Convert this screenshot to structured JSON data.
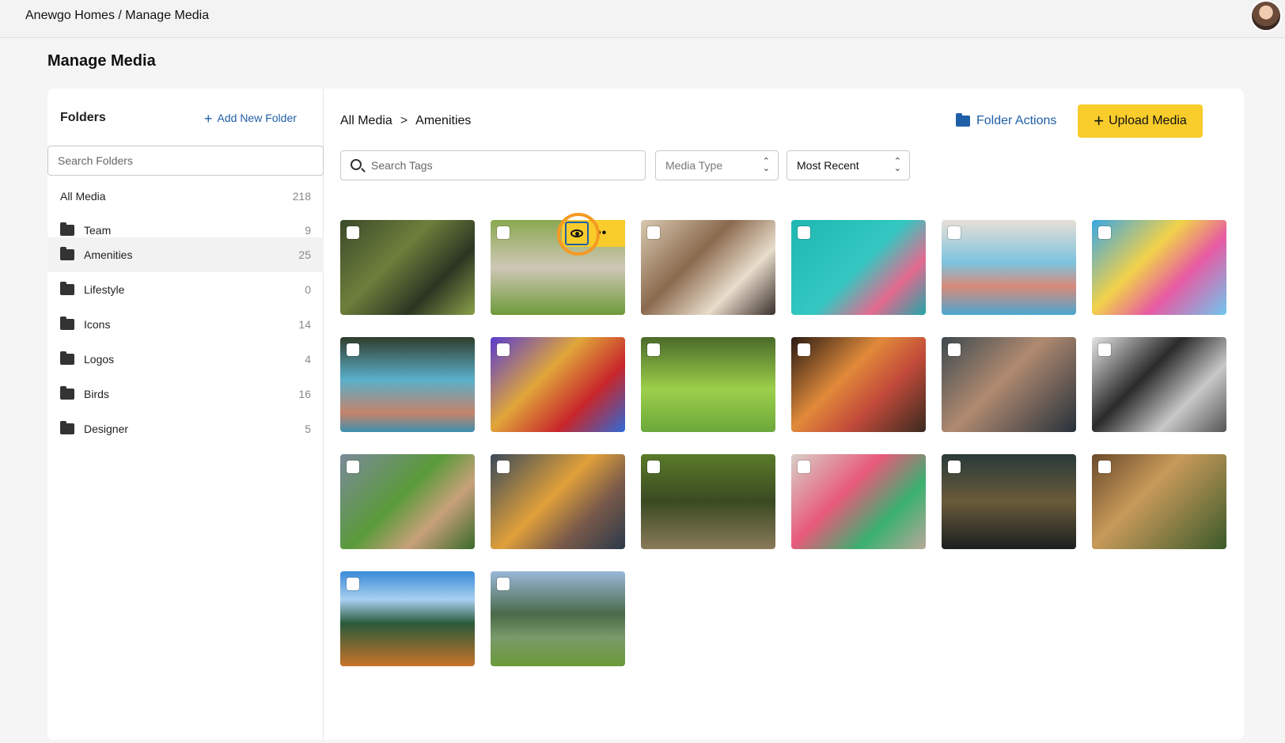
{
  "topbar": {
    "breadcrumb": "Anewgo Homes / Manage Media"
  },
  "page": {
    "title": "Manage Media"
  },
  "sidebar": {
    "title": "Folders",
    "add_folder_label": "Add New Folder",
    "search_placeholder": "Search Folders",
    "all_media": {
      "label": "All Media",
      "count": "218"
    },
    "folders": [
      {
        "label": "Team",
        "count": "9"
      },
      {
        "label": "Amenities",
        "count": "25",
        "active": true
      },
      {
        "label": "Lifestyle",
        "count": "0"
      },
      {
        "label": "Icons",
        "count": "14"
      },
      {
        "label": "Logos",
        "count": "4"
      },
      {
        "label": "Birds",
        "count": "16"
      },
      {
        "label": "Designer",
        "count": "5"
      }
    ]
  },
  "main": {
    "breadcrumb": {
      "root": "All Media",
      "separator": ">",
      "current": "Amenities"
    },
    "folder_actions_label": "Folder Actions",
    "upload_label": "Upload Media",
    "search_tags_placeholder": "Search Tags",
    "media_type_label": "Media Type",
    "sort_label": "Most Recent"
  },
  "colors": {
    "accent_yellow": "#f8cc2b",
    "link_blue": "#1f5fa8",
    "cursor_orange": "#f59a23"
  },
  "thumbnails": [
    {
      "name": "thumb-boardwalk",
      "bg": "linear-gradient(135deg,#3b4a2a 0%,#6e7f3c 40%,#2d3522 70%,#8aa04a 100%)"
    },
    {
      "name": "thumb-dogs",
      "bg": "linear-gradient(180deg,#8aa850 0%,#cfc7b6 50%,#6e9a3a 100%)",
      "hover": true
    },
    {
      "name": "thumb-friends",
      "bg": "linear-gradient(135deg,#d9c9b0 0%,#8a6a4e 40%,#e8dccb 70%,#3a2f2a 100%)"
    },
    {
      "name": "thumb-pool-floats",
      "bg": "linear-gradient(135deg,#1fb7b2 0%,#33c8c1 50%,#e46a8f 75%,#20a6a8 100%)"
    },
    {
      "name": "thumb-pool-kids",
      "bg": "linear-gradient(180deg,#e8dfd6 0%,#7cc3de 45%,#d98a7a 70%,#4aa7d0 100%)"
    },
    {
      "name": "thumb-waterslide",
      "bg": "linear-gradient(135deg,#3aa6e3 0%,#f2d24a 40%,#e75aa3 65%,#6fc7ee 100%)"
    },
    {
      "name": "thumb-hot-tub",
      "bg": "linear-gradient(180deg,#2f3d2c 0%,#5ab0cc 45%,#c4836a 80%,#3d8fb0 100%)"
    },
    {
      "name": "thumb-swing",
      "bg": "linear-gradient(135deg,#5a3bd0 0%,#e0a63a 40%,#c8252a 70%,#2f6ad8 100%)"
    },
    {
      "name": "thumb-soccer",
      "bg": "linear-gradient(180deg,#4a6a2a 0%,#9ccf4a 55%,#6ba83a 100%)"
    },
    {
      "name": "thumb-cocktails",
      "bg": "linear-gradient(135deg,#2a1b14 0%,#e08a3a 40%,#c24a3a 65%,#3a2a20 100%)"
    },
    {
      "name": "thumb-gym-plank",
      "bg": "linear-gradient(135deg,#3d4a4f 0%,#b08a70 45%,#26313a 100%)"
    },
    {
      "name": "thumb-gym-machine",
      "bg": "linear-gradient(135deg,#e5e5e5 0%,#2a2a2a 40%,#c8c8c8 70%,#555 100%)"
    },
    {
      "name": "thumb-farmers-market",
      "bg": "linear-gradient(135deg,#7a8a9a 0%,#5a9a3a 45%,#c8a07a 70%,#3a6a2a 100%)"
    },
    {
      "name": "thumb-shopping-woman",
      "bg": "linear-gradient(135deg,#3a4a5a 0%,#e0a03a 45%,#7a5a4a 70%,#2a3a4a 100%)"
    },
    {
      "name": "thumb-creek-hike",
      "bg": "linear-gradient(180deg,#5a7a2a 0%,#3a4a22 50%,#8a7a5a 100%)"
    },
    {
      "name": "thumb-shopping-friends",
      "bg": "linear-gradient(135deg,#d8d0c8 0%,#e85a7a 40%,#3ab070 70%,#b8a898 100%)"
    },
    {
      "name": "thumb-outdoor-dining",
      "bg": "linear-gradient(180deg,#2a3a3a 0%,#6a5a3a 50%,#1a2020 100%)"
    },
    {
      "name": "thumb-picnic",
      "bg": "linear-gradient(135deg,#6a4a2a 0%,#c89a5a 40%,#3a5a2a 100%)"
    },
    {
      "name": "thumb-lake-chairs",
      "bg": "linear-gradient(180deg,#3a8ad8 0%,#a8d0f0 30%,#2a5a3a 55%,#c8732a 100%)"
    },
    {
      "name": "thumb-pond",
      "bg": "linear-gradient(180deg,#9ab8d8 0%,#4a6a4a 45%,#7a9a6a 70%,#6a9a3a 100%)"
    }
  ]
}
